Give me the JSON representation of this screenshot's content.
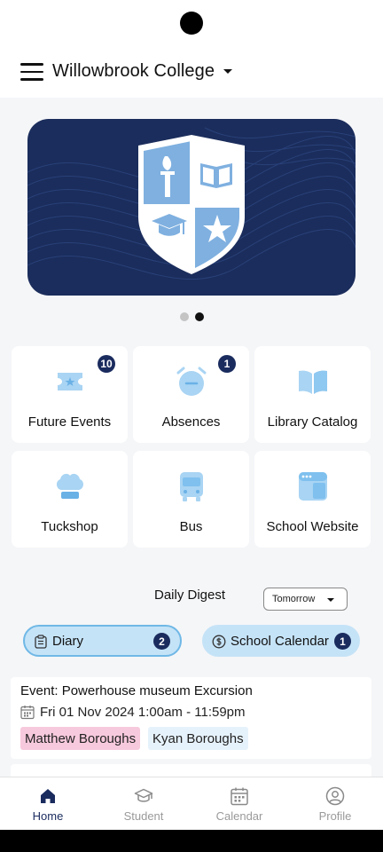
{
  "header": {
    "title": "Willowbrook College",
    "menu_icon": "hamburger-icon",
    "dropdown_icon": "caret-down-icon"
  },
  "carousel": {
    "slide_count": 2,
    "active_index": 1,
    "banner_color": "#1b2d5c",
    "crest_color": "#7fb0e0"
  },
  "tiles": [
    {
      "label": "Future Events",
      "icon": "ticket-icon",
      "badge": "10"
    },
    {
      "label": "Absences",
      "icon": "alarm-clock-icon",
      "badge": "1"
    },
    {
      "label": "Library Catalog",
      "icon": "book-icon",
      "badge": ""
    },
    {
      "label": "Tuckshop",
      "icon": "chef-hat-icon",
      "badge": ""
    },
    {
      "label": "Bus",
      "icon": "bus-icon",
      "badge": ""
    },
    {
      "label": "School Website",
      "icon": "browser-window-icon",
      "badge": ""
    }
  ],
  "digest": {
    "title": "Daily Digest",
    "selected_day": "Tomorrow"
  },
  "filters": {
    "diary": {
      "label": "Diary",
      "count": "2",
      "icon": "clipboard-icon"
    },
    "calendar": {
      "label": "School Calendar",
      "count": "1",
      "icon": "dollar-circle-icon"
    }
  },
  "event": {
    "title": "Event: Powerhouse museum Excursion",
    "datetime": "Fri 01 Nov 2024 1:00am - 11:59pm",
    "students": [
      "Matthew Boroughs",
      "Kyan Boroughs"
    ]
  },
  "nav": [
    {
      "label": "Home",
      "icon": "home-icon",
      "active": true
    },
    {
      "label": "Student",
      "icon": "graduation-cap-icon",
      "active": false
    },
    {
      "label": "Calendar",
      "icon": "calendar-icon",
      "active": false
    },
    {
      "label": "Profile",
      "icon": "user-circle-icon",
      "active": false
    }
  ],
  "colors": {
    "accent_dark": "#1a2b5e",
    "pill_bg": "#c5e3f7",
    "icon_light": "#a9d4f3",
    "tag_pink": "#f7c9dc"
  }
}
